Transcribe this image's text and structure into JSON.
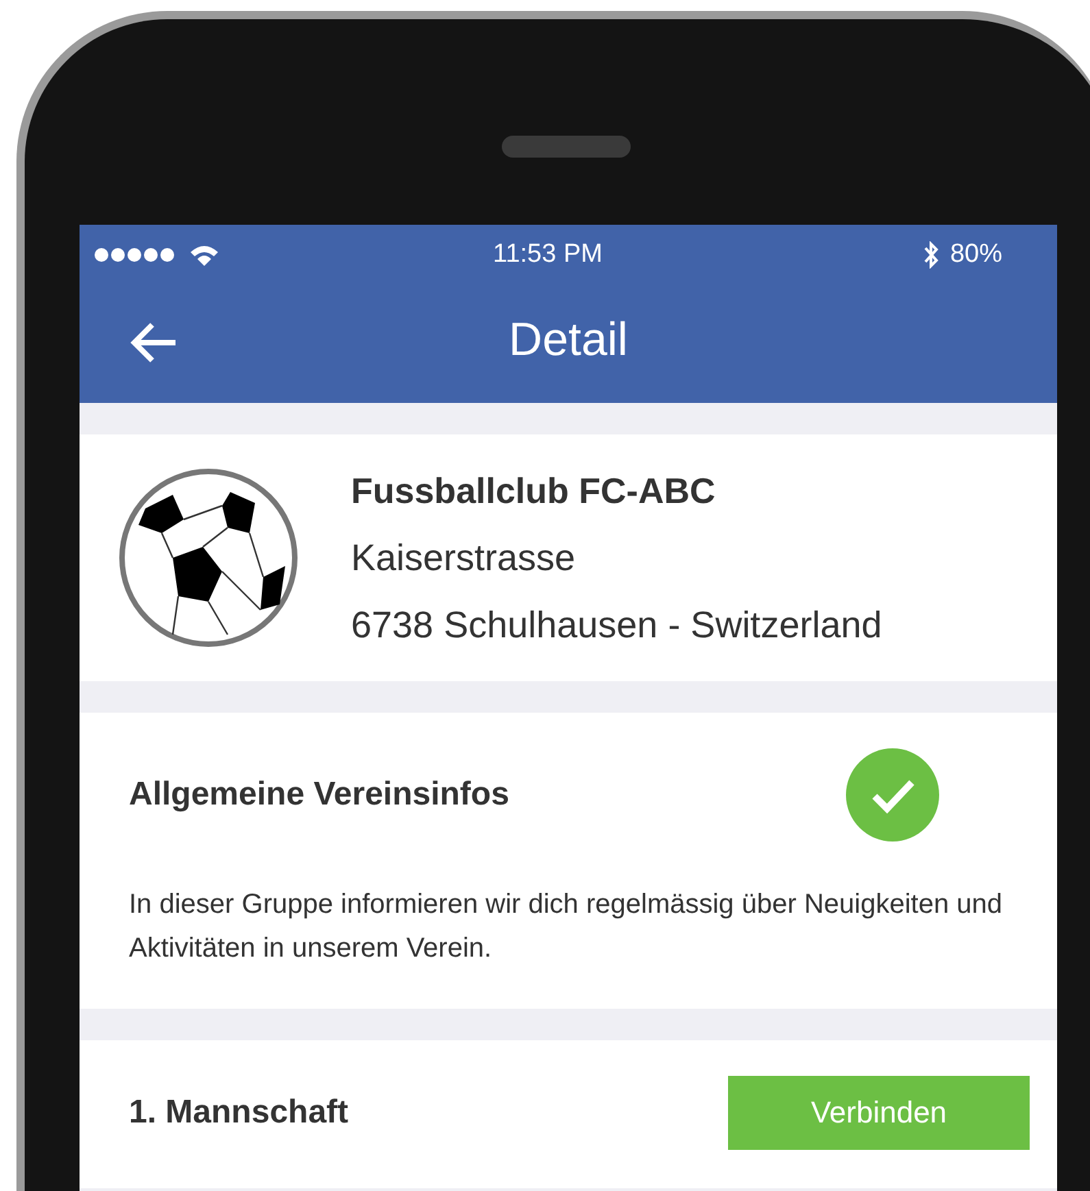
{
  "status_bar": {
    "time": "11:53 PM",
    "battery": "80%"
  },
  "header": {
    "title": "Detail"
  },
  "club": {
    "name": "Fussballclub FC-ABC",
    "street": "Kaiserstrasse",
    "city": "6738 Schulhausen - Switzerland"
  },
  "groups": [
    {
      "title": "Allgemeine Vereinsinfos",
      "joined": true,
      "description": "In dieser Gruppe informieren wir dich regelmässig über Neuigkeiten und Aktivitäten in unserem Verein."
    },
    {
      "title": "1. Mannschaft",
      "joined": false,
      "button": "Verbinden"
    }
  ]
}
